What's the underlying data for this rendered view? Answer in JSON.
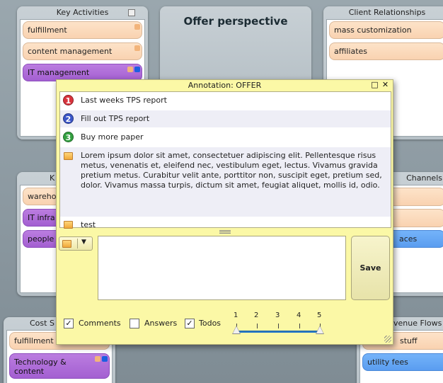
{
  "panels": {
    "key_activities": {
      "title": "Key Activities",
      "notes": [
        "fulfillment",
        "content management",
        "IT management"
      ]
    },
    "offer": {
      "title": "Offer perspective"
    },
    "client_relationships": {
      "title": "Client Relationships",
      "notes": [
        "mass customization",
        "affiliates"
      ]
    },
    "key_resources": {
      "title": "K",
      "notes": [
        "wareho",
        "IT infra",
        "people"
      ]
    },
    "channels": {
      "title": "Channels",
      "notes": [
        "",
        "",
        "aces"
      ]
    },
    "cost_structure": {
      "title": "Cost S",
      "notes": [
        "fulfillment",
        "Technology & content"
      ]
    },
    "revenue_flows": {
      "title": "venue Flows",
      "notes": [
        "stuff",
        "utility fees"
      ]
    }
  },
  "popup": {
    "title": "Annotation: OFFER",
    "items": [
      {
        "kind": "todo",
        "number": "1",
        "color": "#d9333c",
        "text": "Last weeks TPS report"
      },
      {
        "kind": "todo",
        "number": "2",
        "color": "#3b56c8",
        "text": "Fill out TPS report"
      },
      {
        "kind": "todo",
        "number": "3",
        "color": "#33a040",
        "text": "Buy more paper"
      },
      {
        "kind": "comment",
        "text": "Lorem ipsum dolor sit amet, consectetuer adipiscing elit. Pellentesque risus metus, venenatis et, eleifend nec, vestibulum eget, lectus. Vivamus gravida pretium metus. Curabitur velit ante, porttitor non, suscipit eget, pretium sed, dolor. Vivamus massa turpis, dictum sit amet, feugiat aliquet, mollis id, odio."
      },
      {
        "kind": "comment",
        "text": "test"
      }
    ],
    "save_label": "Save",
    "filters": [
      {
        "label": "Comments",
        "checked": true
      },
      {
        "label": "Answers",
        "checked": false
      },
      {
        "label": "Todos",
        "checked": true
      }
    ],
    "slider": {
      "ticks": [
        "1",
        "2",
        "3",
        "4",
        "5"
      ],
      "range": [
        1,
        5
      ]
    },
    "checkmark": "✓",
    "maximize_glyph": "□",
    "close_glyph": "✕",
    "dropdown_glyph": "▼"
  }
}
